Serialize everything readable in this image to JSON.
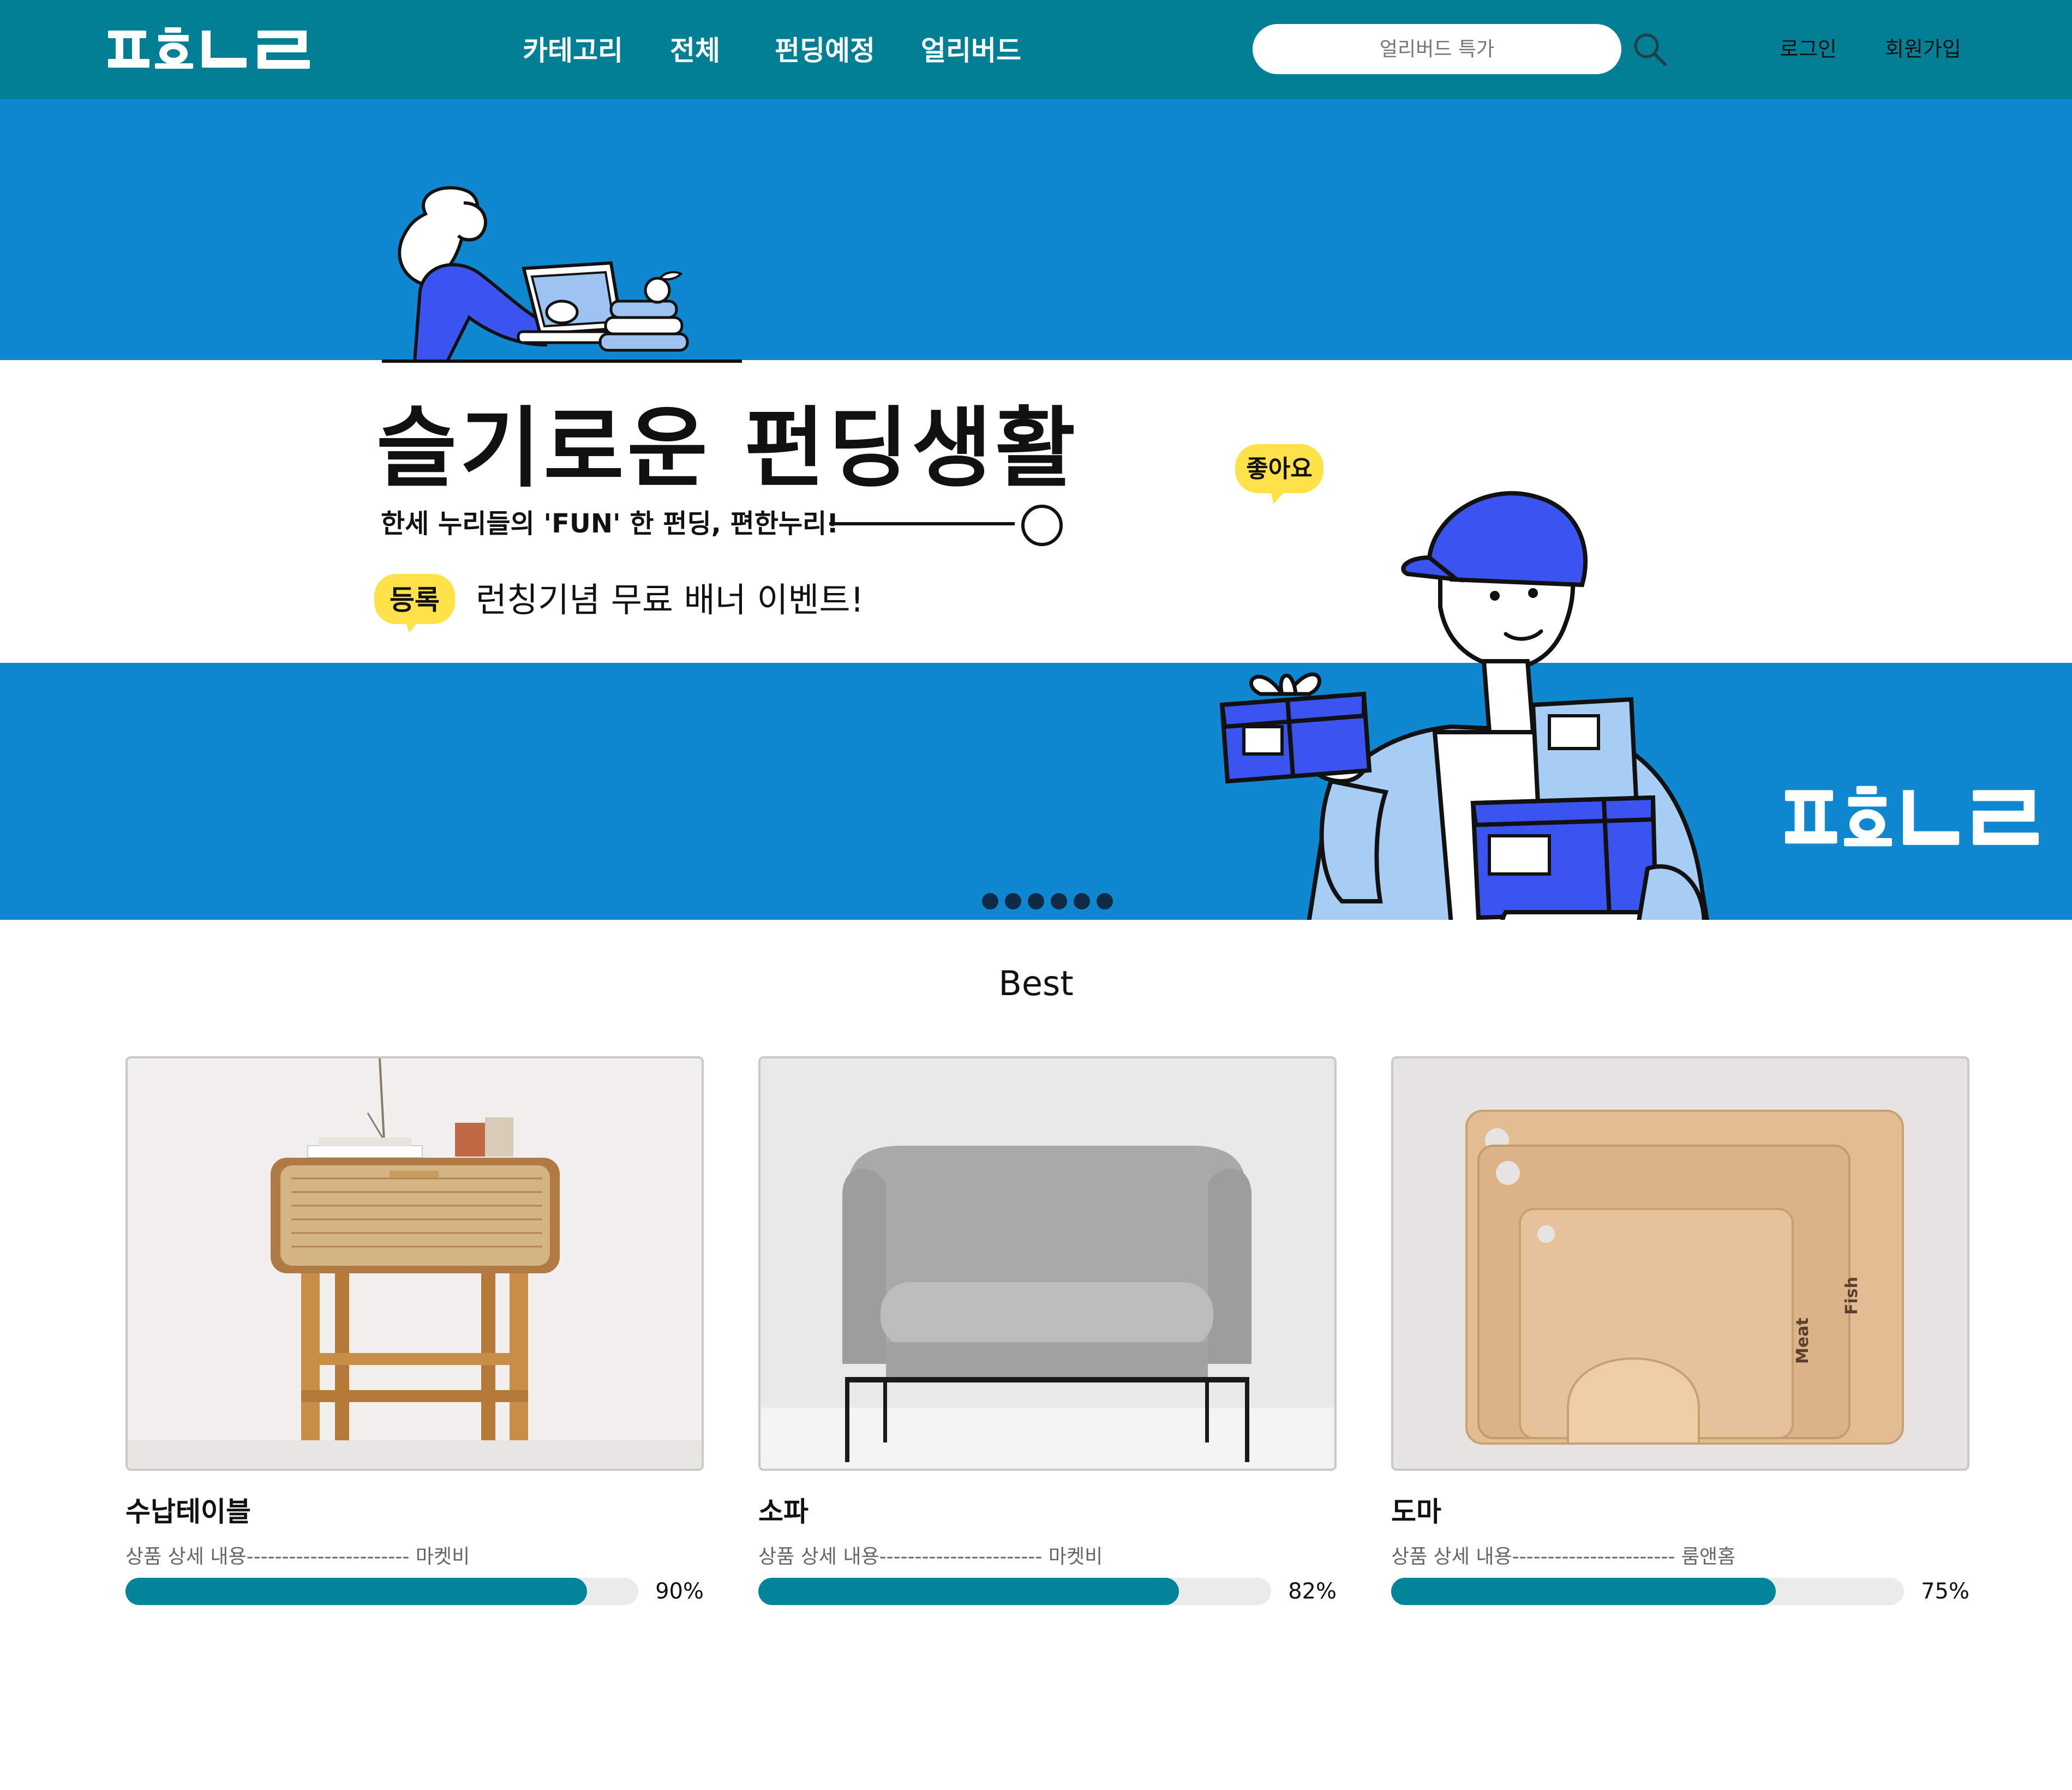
{
  "header": {
    "logo_text": "펀누리",
    "nav": [
      "카테고리",
      "전체",
      "펀딩예정",
      "얼리버드"
    ],
    "search": {
      "placeholder": "얼리버드 특가",
      "value": ""
    },
    "login": "로그인",
    "signup": "회원가입"
  },
  "banner": {
    "headline": "슬기로운 펀딩생활",
    "subline": "한세 누리들의 'FUN' 한 펀딩, 편한누리!",
    "badge": "등록",
    "event_text": "런칭기념 무료 배너 이벤트!",
    "like_badge": "좋아요",
    "slide_count": 6
  },
  "best": {
    "title": "Best",
    "items": [
      {
        "name": "수납테이블",
        "desc": "상품 상세 내용----------------------- 마켓비",
        "progress": 0.9,
        "percent": "90%"
      },
      {
        "name": "소파",
        "desc": "상품 상세 내용----------------------- 마켓비",
        "progress": 0.82,
        "percent": "82%"
      },
      {
        "name": "도마",
        "desc": "상품 상세 내용----------------------- 룸앤홈",
        "progress": 0.75,
        "percent": "75%"
      }
    ]
  },
  "colors": {
    "header_bg": "#027f95",
    "banner_bg": "#0f88d1",
    "progress_fill": "#03849a",
    "badge_yellow": "#ffe14a",
    "accent_blue": "#3b54f0"
  }
}
